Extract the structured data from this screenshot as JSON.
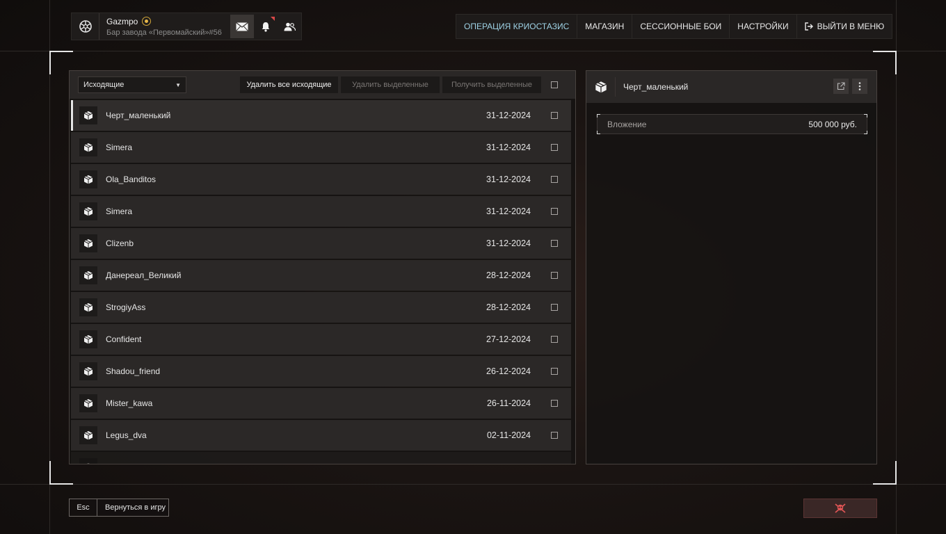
{
  "profile": {
    "username": "Gazmpo",
    "location": "Бар завода «Первомайский»#56"
  },
  "nav": {
    "items": [
      {
        "label": "ОПЕРАЦИЯ КРИОСТАЗИС",
        "active": true
      },
      {
        "label": "МАГАЗИН"
      },
      {
        "label": "СЕССИОННЫЕ БОИ"
      },
      {
        "label": "НАСТРОЙКИ"
      },
      {
        "label": "ВЫЙТИ В МЕНЮ",
        "icon": "exit-icon"
      }
    ]
  },
  "mail": {
    "filter_selected": "Исходящие",
    "delete_all_label": "Удалить все исходящие",
    "delete_selected_label": "Удалить выделенные",
    "receive_selected_label": "Получить выделенные",
    "rows": [
      {
        "name": "Черт_маленький",
        "date": "31-12-2024",
        "selected": true
      },
      {
        "name": "Simera",
        "date": "31-12-2024"
      },
      {
        "name": "Ola_Banditos",
        "date": "31-12-2024"
      },
      {
        "name": "Simera",
        "date": "31-12-2024"
      },
      {
        "name": "Clizenb",
        "date": "31-12-2024"
      },
      {
        "name": "Данереал_Великий",
        "date": "28-12-2024"
      },
      {
        "name": "StrogiyAss",
        "date": "28-12-2024"
      },
      {
        "name": "Confident",
        "date": "27-12-2024"
      },
      {
        "name": "Shadou_friend",
        "date": "26-12-2024"
      },
      {
        "name": "Mister_kawa",
        "date": "26-11-2024"
      },
      {
        "name": "Legus_dva",
        "date": "02-11-2024"
      }
    ]
  },
  "detail": {
    "title": "Черт_маленький",
    "attachment_label": "Вложение",
    "attachment_value": "500 000 руб."
  },
  "footer": {
    "esc_key": "Esc",
    "return_label": "Вернуться в игру"
  },
  "colors": {
    "accent": "#9fd3e6",
    "danger": "#d94848",
    "gold": "#e7b84a"
  }
}
